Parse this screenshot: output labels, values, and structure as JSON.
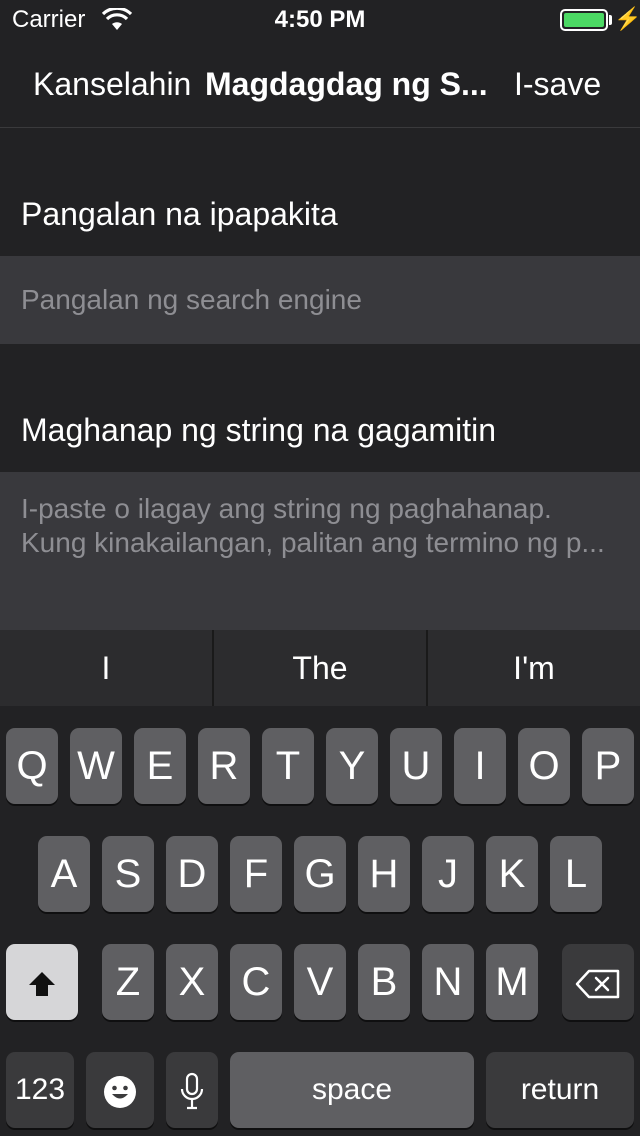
{
  "status": {
    "carrier": "Carrier",
    "time": "4:50 PM",
    "battery_level": 1.0,
    "wifi_icon": "wifi-icon",
    "charging_icon": "bolt-icon",
    "colors": {
      "battery": "#4cd964"
    }
  },
  "nav": {
    "cancel": "Kanselahin",
    "title": "Magdagdag ng S...",
    "save": "I-save"
  },
  "form": {
    "name_label": "Pangalan na ipapakita",
    "name_placeholder": "Pangalan ng search engine",
    "search_label": "Maghanap ng string na gagamitin",
    "search_placeholder_line1": "I-paste o ilagay ang string ng paghahanap.",
    "search_placeholder_line2": "Kung kinakailangan, palitan ang termino ng p..."
  },
  "suggestions": [
    "I",
    "The",
    "I'm"
  ],
  "keyboard": {
    "row1": [
      "Q",
      "W",
      "E",
      "R",
      "T",
      "Y",
      "U",
      "I",
      "O",
      "P"
    ],
    "row2": [
      "A",
      "S",
      "D",
      "F",
      "G",
      "H",
      "J",
      "K",
      "L"
    ],
    "row3": [
      "Z",
      "X",
      "C",
      "V",
      "B",
      "N",
      "M"
    ],
    "numbers": "123",
    "space": "space",
    "return": "return",
    "icons": {
      "shift": "shift-icon",
      "delete": "backspace-icon",
      "emoji": "emoji-icon",
      "mic": "microphone-icon"
    }
  }
}
